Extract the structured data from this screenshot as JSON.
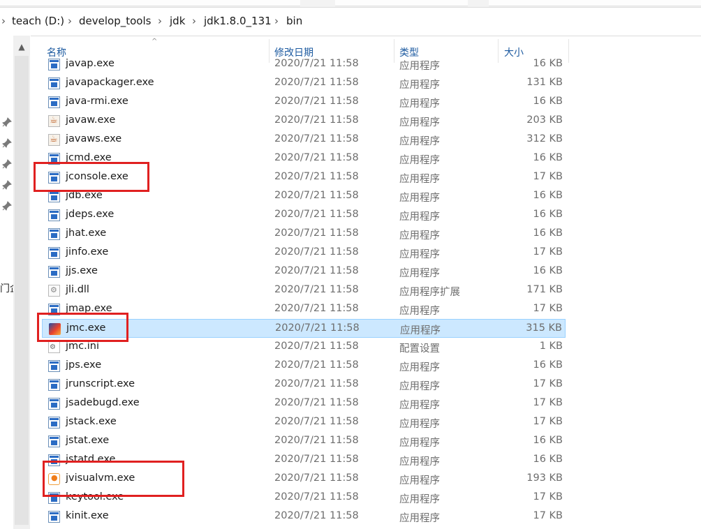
{
  "breadcrumb": {
    "items": [
      "teach (D:)",
      "develop_tools",
      "jdk",
      "jdk1.8.0_131",
      "bin"
    ]
  },
  "nav_cut_text": "门企",
  "columns": {
    "name": "名称",
    "date": "修改日期",
    "type": "类型",
    "size": "大小"
  },
  "files": [
    {
      "name": "javap.exe",
      "date": "2020/7/21 11:58",
      "type": "应用程序",
      "size": "16 KB",
      "icon": "exe-icon"
    },
    {
      "name": "javapackager.exe",
      "date": "2020/7/21 11:58",
      "type": "应用程序",
      "size": "131 KB",
      "icon": "exe-icon"
    },
    {
      "name": "java-rmi.exe",
      "date": "2020/7/21 11:58",
      "type": "应用程序",
      "size": "16 KB",
      "icon": "exe-icon"
    },
    {
      "name": "javaw.exe",
      "date": "2020/7/21 11:58",
      "type": "应用程序",
      "size": "203 KB",
      "icon": "java-icon"
    },
    {
      "name": "javaws.exe",
      "date": "2020/7/21 11:58",
      "type": "应用程序",
      "size": "312 KB",
      "icon": "java-icon"
    },
    {
      "name": "jcmd.exe",
      "date": "2020/7/21 11:58",
      "type": "应用程序",
      "size": "16 KB",
      "icon": "exe-icon"
    },
    {
      "name": "jconsole.exe",
      "date": "2020/7/21 11:58",
      "type": "应用程序",
      "size": "17 KB",
      "icon": "exe-icon"
    },
    {
      "name": "jdb.exe",
      "date": "2020/7/21 11:58",
      "type": "应用程序",
      "size": "16 KB",
      "icon": "exe-icon"
    },
    {
      "name": "jdeps.exe",
      "date": "2020/7/21 11:58",
      "type": "应用程序",
      "size": "16 KB",
      "icon": "exe-icon"
    },
    {
      "name": "jhat.exe",
      "date": "2020/7/21 11:58",
      "type": "应用程序",
      "size": "16 KB",
      "icon": "exe-icon"
    },
    {
      "name": "jinfo.exe",
      "date": "2020/7/21 11:58",
      "type": "应用程序",
      "size": "17 KB",
      "icon": "exe-icon"
    },
    {
      "name": "jjs.exe",
      "date": "2020/7/21 11:58",
      "type": "应用程序",
      "size": "16 KB",
      "icon": "exe-icon"
    },
    {
      "name": "jli.dll",
      "date": "2020/7/21 11:58",
      "type": "应用程序扩展",
      "size": "171 KB",
      "icon": "dll-icon"
    },
    {
      "name": "jmap.exe",
      "date": "2020/7/21 11:58",
      "type": "应用程序",
      "size": "17 KB",
      "icon": "exe-icon"
    },
    {
      "name": "jmc.exe",
      "date": "2020/7/21 11:58",
      "type": "应用程序",
      "size": "315 KB",
      "icon": "jmc-icon",
      "selected": true
    },
    {
      "name": "jmc.ini",
      "date": "2020/7/21 11:58",
      "type": "配置设置",
      "size": "1 KB",
      "icon": "ini-icon"
    },
    {
      "name": "jps.exe",
      "date": "2020/7/21 11:58",
      "type": "应用程序",
      "size": "16 KB",
      "icon": "exe-icon"
    },
    {
      "name": "jrunscript.exe",
      "date": "2020/7/21 11:58",
      "type": "应用程序",
      "size": "17 KB",
      "icon": "exe-icon"
    },
    {
      "name": "jsadebugd.exe",
      "date": "2020/7/21 11:58",
      "type": "应用程序",
      "size": "17 KB",
      "icon": "exe-icon"
    },
    {
      "name": "jstack.exe",
      "date": "2020/7/21 11:58",
      "type": "应用程序",
      "size": "17 KB",
      "icon": "exe-icon"
    },
    {
      "name": "jstat.exe",
      "date": "2020/7/21 11:58",
      "type": "应用程序",
      "size": "16 KB",
      "icon": "exe-icon"
    },
    {
      "name": "jstatd.exe",
      "date": "2020/7/21 11:58",
      "type": "应用程序",
      "size": "16 KB",
      "icon": "exe-icon"
    },
    {
      "name": "jvisualvm.exe",
      "date": "2020/7/21 11:58",
      "type": "应用程序",
      "size": "193 KB",
      "icon": "jvisualvm-icon"
    },
    {
      "name": "keytool.exe",
      "date": "2020/7/21 11:58",
      "type": "应用程序",
      "size": "17 KB",
      "icon": "exe-icon"
    },
    {
      "name": "kinit.exe",
      "date": "2020/7/21 11:58",
      "type": "应用程序",
      "size": "17 KB",
      "icon": "exe-icon"
    }
  ],
  "highlight_color": "#e02020",
  "selection_color": "#cce8ff"
}
